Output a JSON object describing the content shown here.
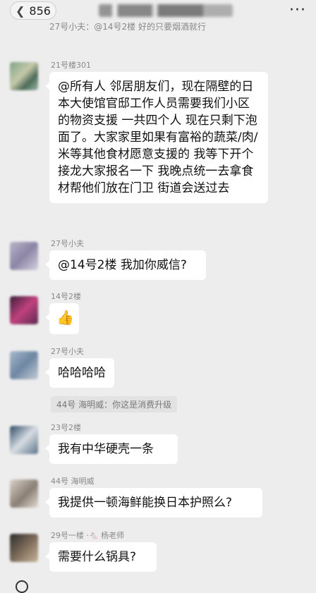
{
  "header": {
    "back_count": "856",
    "back_icon": "chevron-left-icon",
    "title_redacted": "",
    "more_icon": "ellipsis-icon"
  },
  "quote": {
    "text": "27号小夫：@14号2楼 好的只要烟酒就行"
  },
  "messages": [
    {
      "sender": "21号楼301",
      "text": "@所有人 邻居朋友们，现在隔壁的日本大使馆官邸工作人员需要我们小区的物资支援 一共四个人 现在只剩下泡面了。大家家里如果有富裕的蔬菜/肉/米等其他食材愿意支援的 我等下开个接龙大家报名一下 我晚点统一去拿食材帮他们放在门卫 街道会送过去"
    },
    {
      "sender": "27号小夫",
      "text": "@14号2楼 我加你威信?"
    },
    {
      "sender": "14号2楼",
      "text": "👍",
      "emoji_icon": "thumbs-up-icon"
    },
    {
      "sender": "27号小夫",
      "text": "哈哈哈哈"
    },
    {
      "system": "44号 海明威：你这是消费升级"
    },
    {
      "sender": "23号2楼",
      "text": "我有中华硬壳一条"
    },
    {
      "sender": "44号 海明威",
      "text": "我提供一顿海鲜能换日本护照么?"
    },
    {
      "sender": "29号一楼 ·🐁 杨老师",
      "text": "需要什么锅具?"
    }
  ],
  "colors": {
    "background": "#ededed",
    "bubble": "#ffffff",
    "meta_text": "#888888"
  }
}
